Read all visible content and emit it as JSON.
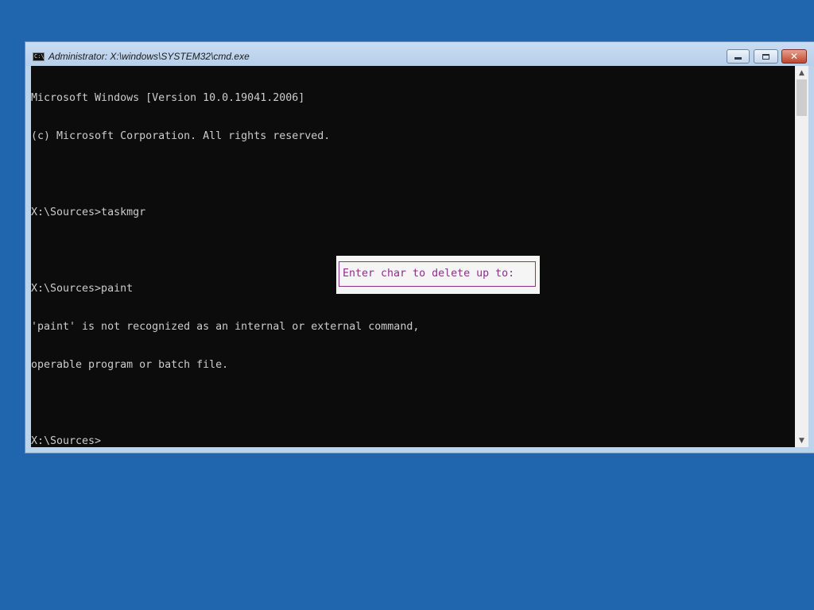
{
  "window": {
    "title": "Administrator: X:\\windows\\SYSTEM32\\cmd.exe",
    "icon": "console-icon",
    "controls": {
      "minimize_icon": "minimize-icon",
      "maximize_icon": "maximize-icon",
      "close_glyph": "✕"
    }
  },
  "console": {
    "lines": [
      "Microsoft Windows [Version 10.0.19041.2006]",
      "(c) Microsoft Corporation. All rights reserved.",
      "",
      "X:\\Sources>taskmgr",
      "",
      "X:\\Sources>paint",
      "'paint' is not recognized as an internal or external command,",
      "operable program or batch file.",
      "",
      "X:\\Sources>"
    ],
    "text_color": "#cccccc",
    "background_color": "#0c0c0c"
  },
  "popup": {
    "prompt": "Enter char to delete up to: ",
    "text_color": "#8b2f8b"
  },
  "scrollbar": {
    "up_arrow": "▲",
    "down_arrow": "▼"
  },
  "desktop": {
    "background_color": "#1f66ae"
  }
}
